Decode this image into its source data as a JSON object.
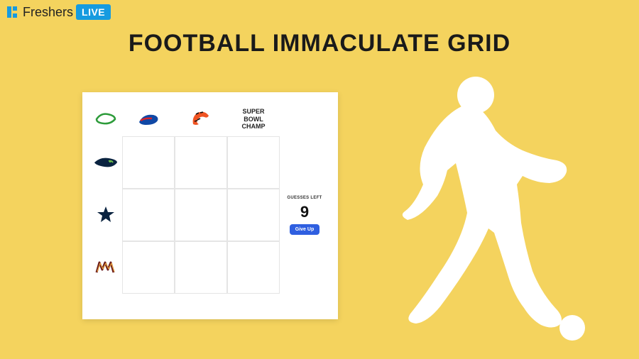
{
  "brand": {
    "name": "Freshers",
    "badge": "LIVE"
  },
  "headline": "FOOTBALL IMMACULATE GRID",
  "grid": {
    "col_headers": [
      "bills",
      "bengals"
    ],
    "col_text_header": {
      "line1": "SUPER",
      "line2": "BOWL",
      "line3": "CHAMP"
    },
    "row_headers": [
      "seahawks",
      "cowboys",
      "commanders"
    ],
    "corner_logo": "stubhub"
  },
  "guesses": {
    "label": "GUESSES LEFT",
    "count": "9",
    "giveup": "Give Up"
  }
}
